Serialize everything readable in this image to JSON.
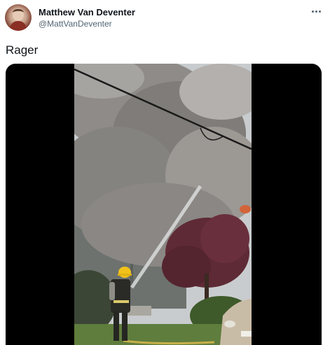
{
  "tweet": {
    "author_name": "Matthew Van Deventer",
    "author_handle": "@MattVanDeventer",
    "text": "Rager"
  },
  "icons": {
    "avatar": "avatar-photo",
    "more": "more-horizontal-icon"
  },
  "colors": {
    "text_primary": "#0f1419",
    "text_secondary": "#536471",
    "media_background": "#000000",
    "smoke": "#8c8986",
    "helmet": "#f2c21b",
    "tree": "#6a2f3c"
  }
}
